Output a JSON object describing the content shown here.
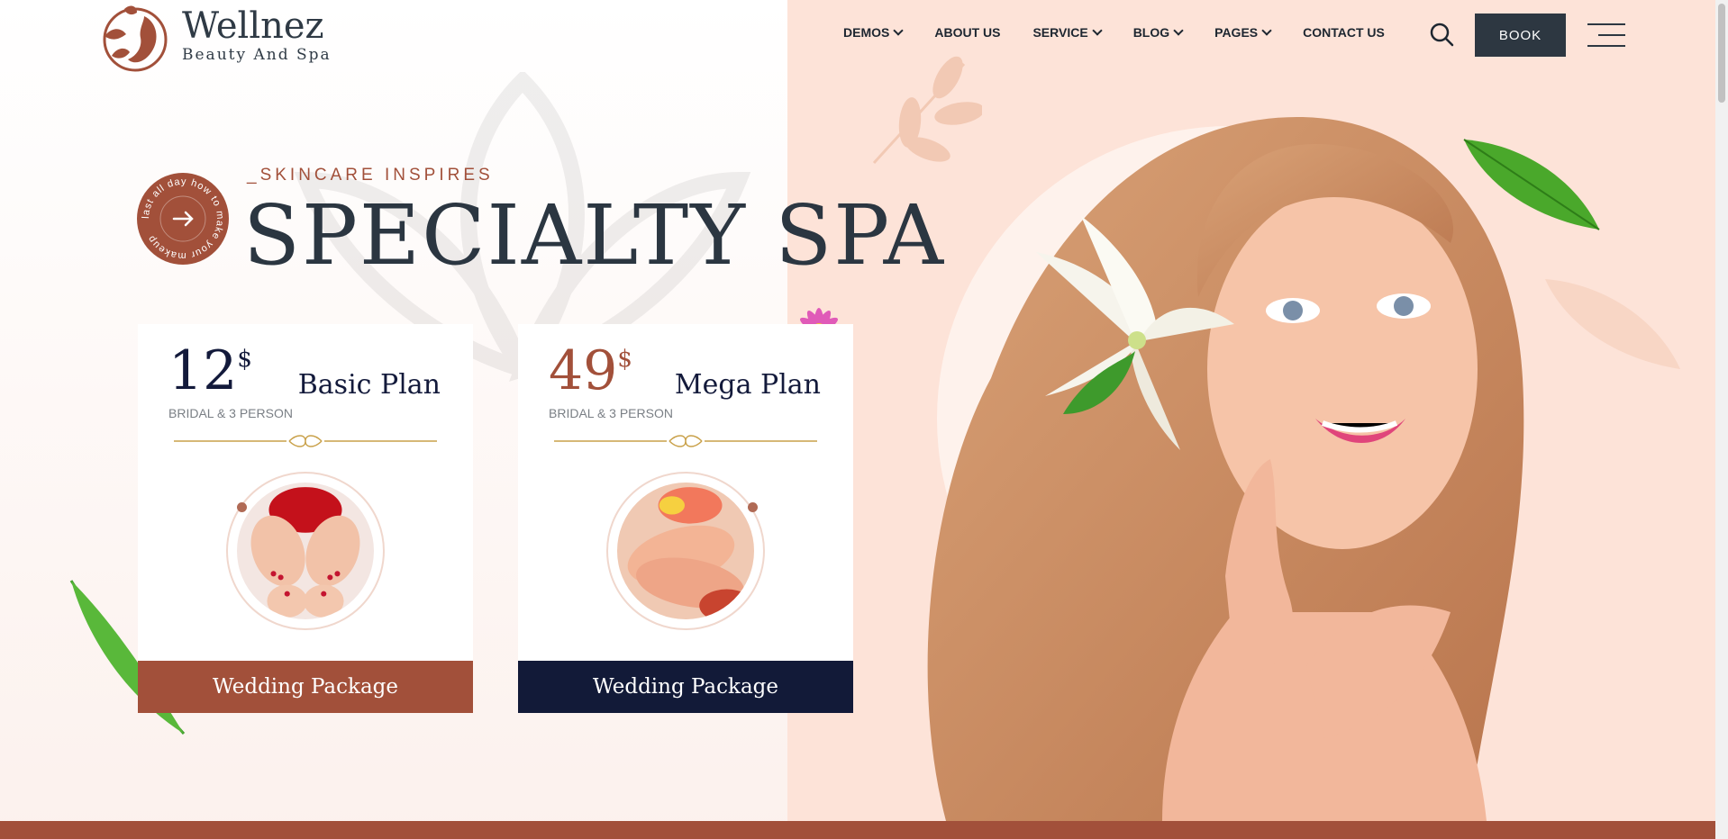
{
  "brand": {
    "name": "Wellnez",
    "tagline": "Beauty And Spa"
  },
  "nav": {
    "items": [
      {
        "label": "DEMOS",
        "dropdown": true
      },
      {
        "label": "ABOUT US",
        "dropdown": false
      },
      {
        "label": "SERVICE",
        "dropdown": true
      },
      {
        "label": "BLOG",
        "dropdown": true
      },
      {
        "label": "PAGES",
        "dropdown": true
      },
      {
        "label": "CONTACT US",
        "dropdown": false
      }
    ],
    "book_label": "BOOK",
    "icons": {
      "search": "search-icon",
      "menu": "hamburger-menu-icon",
      "dropdown": "chevron-down-icon"
    }
  },
  "hero": {
    "eyebrow": "_SKINCARE INSPIRES",
    "title": "SPECIALTY SPA",
    "badge_text": "last all day how to make your makeup",
    "badge_icon": "arrow-right-icon"
  },
  "plans": [
    {
      "price": "12",
      "currency": "$",
      "subtitle": "BRIDAL & 3 PERSON",
      "name": "Basic Plan",
      "button": "Wedding Package",
      "accent": "#a2503a"
    },
    {
      "price": "49",
      "currency": "$",
      "subtitle": "BRIDAL & 3 PERSON",
      "name": "Mega Plan",
      "button": "Wedding Package",
      "accent": "#121a38"
    }
  ],
  "colors": {
    "brand": "#a2503a",
    "navy": "#121a38",
    "dark": "#2d3741",
    "peach": "#fde3d8"
  }
}
